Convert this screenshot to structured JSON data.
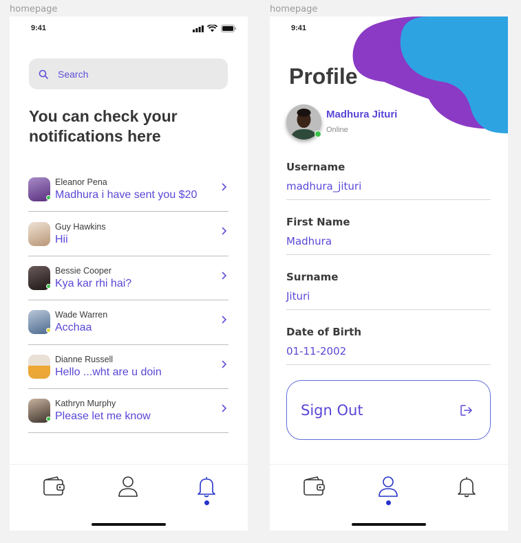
{
  "left_screen": {
    "frame_label": "homepage",
    "time": "9:41",
    "search_placeholder": "Search",
    "heading": "You can check your notifications here",
    "notifications": [
      {
        "name": "Eleanor Pena",
        "message": "Madhura i have sent you $20",
        "status": "online",
        "status_color": "#3bc24b",
        "avatar_color": "#7a4b9c"
      },
      {
        "name": "Guy Hawkins",
        "message": "Hii",
        "status": "none",
        "status_color": "",
        "avatar_color": "#c9a88a"
      },
      {
        "name": "Bessie Cooper",
        "message": "Kya kar rhi hai?",
        "status": "online",
        "status_color": "#3bc24b",
        "avatar_color": "#3b2f2f"
      },
      {
        "name": "Wade Warren",
        "message": "Acchaa",
        "status": "away",
        "status_color": "#e6d93f",
        "avatar_color": "#6e87a8"
      },
      {
        "name": "Dianne Russell",
        "message": "Hello ...wht are u doin",
        "status": "none",
        "status_color": "",
        "avatar_color": "#e8a73a"
      },
      {
        "name": "Kathryn Murphy",
        "message": "Please let me know",
        "status": "online",
        "status_color": "#3bc24b",
        "avatar_color": "#6b5a4c"
      }
    ],
    "tabs": [
      {
        "icon": "wallet-icon",
        "active": false
      },
      {
        "icon": "user-icon",
        "active": false
      },
      {
        "icon": "bell-icon",
        "active": true
      }
    ]
  },
  "right_screen": {
    "frame_label": "homepage",
    "time": "9:41",
    "title": "Profile",
    "user": {
      "name": "Madhura Jituri",
      "status": "Online"
    },
    "fields": [
      {
        "label": "Username",
        "value": "madhura_jituri"
      },
      {
        "label": "First Name",
        "value": "Madhura"
      },
      {
        "label": "Surname",
        "value": "Jituri"
      },
      {
        "label": "Date of Birth",
        "value": "01-11-2002"
      }
    ],
    "signout_label": "Sign Out",
    "tabs": [
      {
        "icon": "wallet-icon",
        "active": false
      },
      {
        "icon": "user-icon",
        "active": true
      },
      {
        "icon": "bell-icon",
        "active": false
      }
    ]
  },
  "colors": {
    "accent": "#5847d6",
    "active_dot": "#2533c8",
    "blob_purple": "#8a3ac4",
    "blob_blue": "#2ea3e2",
    "online": "#3bc24b",
    "away": "#e6d93f"
  }
}
